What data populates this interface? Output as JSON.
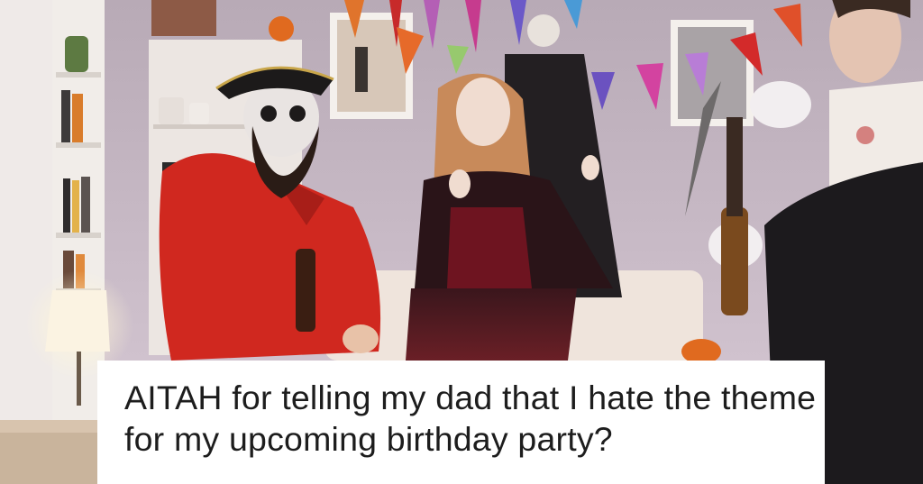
{
  "caption": {
    "text": "AITAH for telling my dad that I hate the theme for my upcoming birthday party?"
  },
  "colors": {
    "wall": "#c6b8c6",
    "pirate_shirt": "#d0281f",
    "vampire_dress": "#2a1418",
    "zombie_robe": "#1c1a1d",
    "caption_bg": "#ffffff",
    "caption_text": "#1d1d1d"
  }
}
